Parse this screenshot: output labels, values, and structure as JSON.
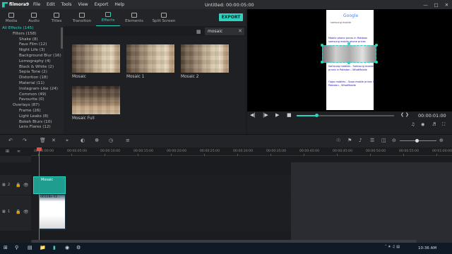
{
  "app": {
    "logo_text": "filmora9",
    "window_title": "Untitled: 00:00:05:00",
    "accent": "#2ed3c0"
  },
  "menu": [
    "File",
    "Edit",
    "Tools",
    "View",
    "Export",
    "Help"
  ],
  "window_controls": [
    "—",
    "□",
    "✕"
  ],
  "tabs": [
    {
      "label": "Media",
      "icon": "media-icon"
    },
    {
      "label": "Audio",
      "icon": "music-icon"
    },
    {
      "label": "Titles",
      "icon": "titles-icon"
    },
    {
      "label": "Transition",
      "icon": "transition-icon"
    },
    {
      "label": "Effects",
      "icon": "effects-icon",
      "active": true
    },
    {
      "label": "Elements",
      "icon": "elements-icon"
    },
    {
      "label": "Split Screen",
      "icon": "split-screen-icon"
    }
  ],
  "export_label": "EXPORT",
  "categories": [
    {
      "label": "All Effects (145)",
      "level": 1,
      "selected": true
    },
    {
      "label": "Filters (158)",
      "level": 0
    },
    {
      "label": "Shake (8)",
      "level": 2
    },
    {
      "label": "Faux Film (12)",
      "level": 2
    },
    {
      "label": "Night Life (3)",
      "level": 2
    },
    {
      "label": "Background Blur (16)",
      "level": 2
    },
    {
      "label": "Lomography (4)",
      "level": 2
    },
    {
      "label": "Black & White (2)",
      "level": 2
    },
    {
      "label": "Sepia Tone (2)",
      "level": 2
    },
    {
      "label": "Distortion (18)",
      "level": 2
    },
    {
      "label": "Material (11)",
      "level": 2
    },
    {
      "label": "Instagram-Like (24)",
      "level": 2
    },
    {
      "label": "Common (49)",
      "level": 2
    },
    {
      "label": "Favourite (0)",
      "level": 2
    },
    {
      "label": "Overlays (87)",
      "level": 0
    },
    {
      "label": "Frame (26)",
      "level": 2
    },
    {
      "label": "Light Leaks (8)",
      "level": 2
    },
    {
      "label": "Bokeh Blurs (10)",
      "level": 2
    },
    {
      "label": "Lens Flares (12)",
      "level": 2
    }
  ],
  "search": {
    "value": "mosaic",
    "clear": "✕"
  },
  "effects": [
    {
      "label": "Mosaic"
    },
    {
      "label": "Mosaic 1"
    },
    {
      "label": "Mosaic 2"
    },
    {
      "label": "Mosaic Full"
    }
  ],
  "preview": {
    "time": "00:00:01:00",
    "progress": 0.2,
    "phone_lines": [
      "Google",
      "samsung mobile",
      "Mobile phone prices in Pakistan",
      "samsung mobile phone prices",
      "Samsung mobiles - Samsung mobile",
      "prices in Pakistan - WhatMobile",
      "Oppo mobiles - Oppo mobile prices in",
      "Pakistan - WhatMobile"
    ]
  },
  "timeline": {
    "ruler": [
      "00:00:00:00",
      "00:00:05:00",
      "00:00:10:00",
      "00:00:15:00",
      "00:00:20:00",
      "00:00:25:00",
      "00:00:30:00",
      "00:00:35:00",
      "00:00:40:00",
      "00:00:45:00",
      "00:00:50:00",
      "00:00:55:00",
      "00:01:00:00"
    ],
    "tracks": [
      {
        "num": "2",
        "clip": "Mosaic"
      },
      {
        "num": "1",
        "clip": "d0328e-02..."
      }
    ]
  },
  "taskbar": {
    "time": "10:36 AM",
    "date": "",
    "search_icon": "search-icon"
  }
}
